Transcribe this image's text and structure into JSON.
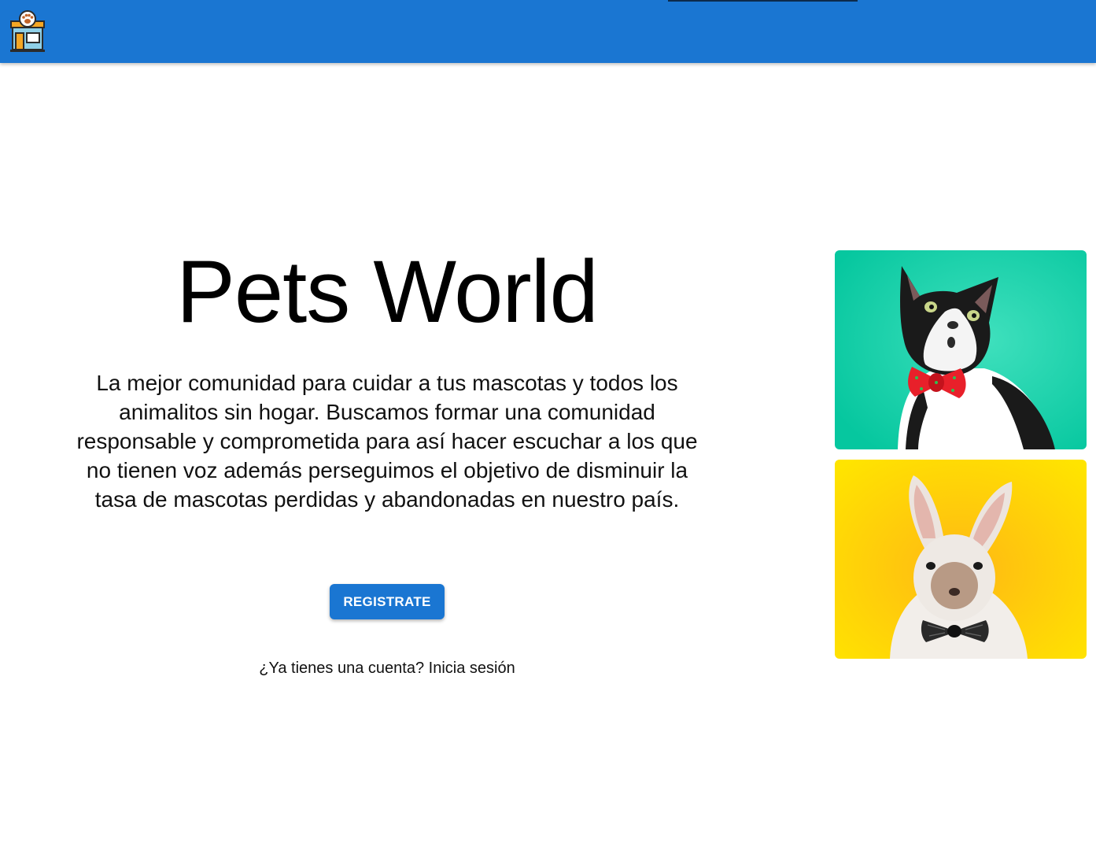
{
  "appbar": {
    "logo_icon": "pet-shop-icon",
    "color": "#1a76d2"
  },
  "hero": {
    "title": "Pets World",
    "description": "La mejor comunidad para cuidar a tus mascotas y todos los animalitos sin hogar. Buscamos formar una comunidad responsable y comprometida para así hacer escuchar a los que no tienen voz además perseguimos el objetivo de disminuir la tasa de mascotas perdidas y abandonadas en nuestro país.",
    "cta_label": "REGISTRATE",
    "login_prompt": "¿Ya tienes una cuenta?",
    "login_link": "Inicia sesión"
  },
  "images": [
    {
      "subject": "cat-with-red-bow-tie",
      "background": "#10cfa6"
    },
    {
      "subject": "bunny-with-black-bow-tie",
      "background": "#ffd400"
    }
  ]
}
